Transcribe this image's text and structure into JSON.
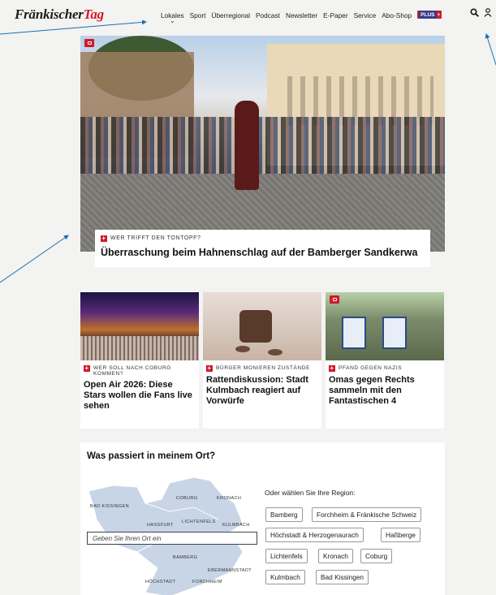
{
  "header": {
    "logo_part1": "Fränkischer",
    "logo_part2": "Tag",
    "nav": [
      "Lokales",
      "Sport",
      "Überregional",
      "Podcast",
      "Newsletter",
      "E-Paper",
      "Service",
      "Abo-Shop"
    ],
    "plus_label": "PLUS",
    "plus_sign": "+"
  },
  "hero": {
    "kicker": "WER TRIFFT DEN TONTOPF?",
    "title": "Überraschung beim Hahnenschlag auf der Bamberger Sandkerwa"
  },
  "cards": [
    {
      "kicker": "WER SOLL NACH COBURG KOMMEN?",
      "title": "Open Air 2026: Diese Stars wollen die Fans live sehen"
    },
    {
      "kicker": "BÜRGER MONIEREN ZUSTÄNDE",
      "title": "Rattendiskussion: Stadt Kulmbach reagiert auf Vorwürfe"
    },
    {
      "kicker": "PFAND GEGEN NAZIS",
      "title": "Omas gegen Rechts sammeln mit den Fantastischen 4"
    }
  ],
  "region": {
    "title": "Was passiert in meinem Ort?",
    "input_placeholder": "Geben Sie Ihren Ort ein",
    "subtitle": "Oder wählen Sie Ihre Region:",
    "map_labels": [
      "BAD KISSINGEN",
      "COBURG",
      "KRONACH",
      "HASSFURT",
      "LICHTENFELS",
      "KULMBACH",
      "BAMBERG",
      "EBERMANNSTADT",
      "HÖCHSTADT",
      "FORCHHEIM"
    ],
    "chips": [
      "Bamberg",
      "Forchheim & Fränkische Schweiz",
      "Höchstadt & Herzogenaurach",
      "Haßberge",
      "Lichtenfels",
      "Kronach",
      "Coburg",
      "Kulmbach",
      "Bad Kissingen"
    ]
  },
  "colors": {
    "accent": "#d1192b",
    "background": "#f3f3f1",
    "annotation": "#1a6fb3"
  },
  "icons": [
    "search-icon",
    "user-icon",
    "camera-icon",
    "video-icon",
    "plus-icon"
  ]
}
